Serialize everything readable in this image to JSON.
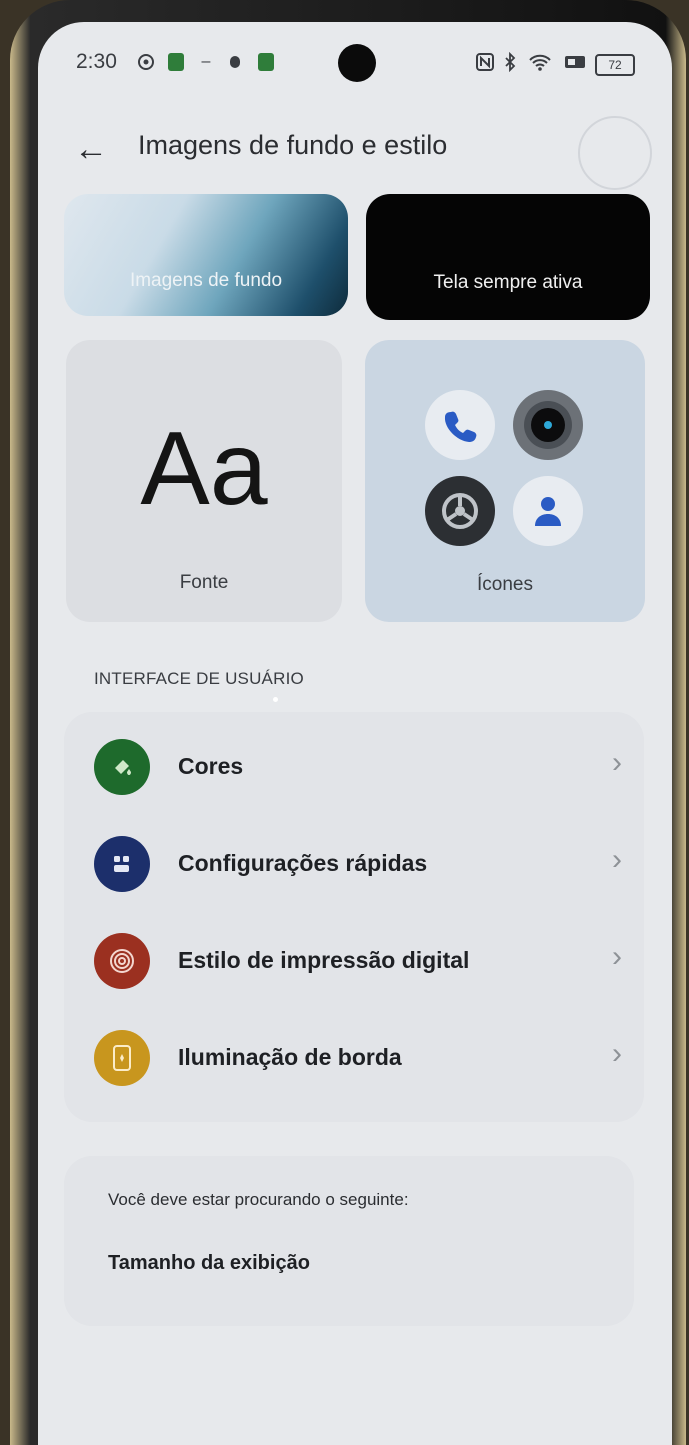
{
  "status": {
    "time": "2:30",
    "battery": "72",
    "icons": [
      "whatsapp-icon",
      "app-icon",
      "minus-icon",
      "mouse-icon",
      "app-icon",
      "nfc-icon",
      "bluetooth-icon",
      "wifi-icon",
      "hotspot-icon"
    ]
  },
  "header": {
    "back_glyph": "←",
    "title": "Imagens de fundo e estilo"
  },
  "cards": {
    "wallpaper": "Imagens de fundo",
    "aod": "Tela sempre ativa",
    "font_sample": "Aa",
    "font": "Fonte",
    "icons": "Ícones"
  },
  "section_title": "INTERFACE DE USUÁRIO",
  "list": [
    {
      "label": "Cores",
      "icon": "paint-bucket-icon",
      "color": "#1e6a2c"
    },
    {
      "label": "Configurações rápidas",
      "icon": "quick-settings-icon",
      "color": "#1c2f6b"
    },
    {
      "label": "Estilo de impressão digital",
      "icon": "fingerprint-icon",
      "color": "#9b3020"
    },
    {
      "label": "Iluminação de borda",
      "icon": "edge-light-icon",
      "color": "#c8961e"
    }
  ],
  "suggest": {
    "hint": "Você deve estar procurando o seguinte:",
    "link": "Tamanho da exibição"
  },
  "colors": {
    "background": "#e7e9ec",
    "card": "#e2e4e8",
    "icons_card": "#cad6e2"
  }
}
